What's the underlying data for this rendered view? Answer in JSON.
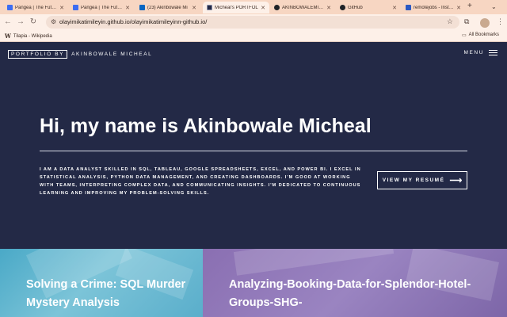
{
  "browser": {
    "tabs": [
      {
        "label": "Pangea | The Future",
        "favicon_color": "#3d6df2",
        "active": false
      },
      {
        "label": "Pangea | The Future",
        "favicon_color": "#3d6df2",
        "active": false
      },
      {
        "label": "(23) Akinbowale Mi",
        "favicon_color": "#0a66c2",
        "active": false
      },
      {
        "label": "Micheal's PORTFOL",
        "favicon_color": "#232946",
        "active": true
      },
      {
        "label": "AKINBOWALEMICH",
        "favicon_color": "#1f2328",
        "active": false
      },
      {
        "label": "GitHub",
        "favicon_color": "#1f2328",
        "active": false
      },
      {
        "label": "remotejobs - Instup",
        "favicon_color": "#2b59c3",
        "active": false
      }
    ],
    "url": "olayimikatimileyin.github.io/olayimikatimileyinn-github.io/",
    "bookmarks": [
      {
        "label": "Tilapia - Wikipedia",
        "icon": "W"
      }
    ],
    "all_bookmarks_label": "All Bookmarks"
  },
  "site": {
    "brand_box": "PORTFOLIO BY",
    "brand_name": "AKINBOWALE MICHEAL",
    "menu_label": "MENU",
    "headline": "Hi, my name is Akinbowale Micheal",
    "bio": "I AM A DATA ANALYST SKILLED IN SQL, TABLEAU, GOOGLE SPREADSHEETS, EXCEL, AND POWER BI. I EXCEL IN STATISTICAL ANALYSIS, PYTHON DATA MANAGEMENT, AND CREATING DASHBOARDS. I'M GOOD AT WORKING WITH TEAMS, INTERPRETING COMPLEX DATA, AND COMMUNICATING INSIGHTS. I'M DEDICATED TO CONTINUOUS LEARNING AND IMPROVING MY PROBLEM-SOLVING SKILLS.",
    "resume_label": "VIEW MY RESUMÉ",
    "projects": [
      {
        "title": "Solving a Crime: SQL Murder Mystery Analysis"
      },
      {
        "title": "Analyzing-Booking-Data-for-Splendor-Hotel-Groups-SHG-"
      }
    ]
  }
}
